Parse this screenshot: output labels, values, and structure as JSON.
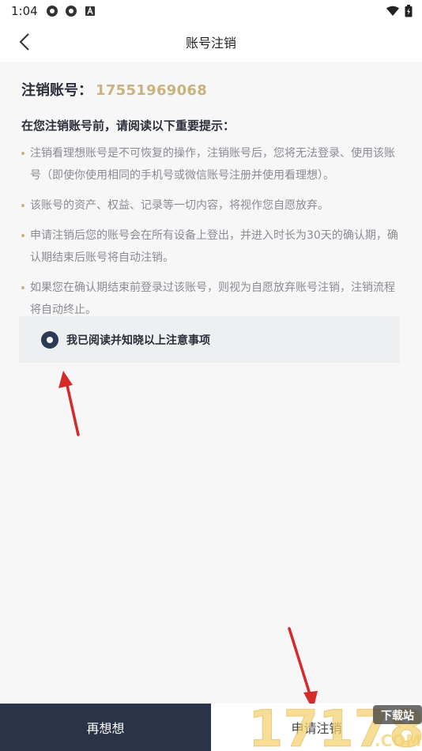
{
  "status_bar": {
    "time": "1:04"
  },
  "header": {
    "title": "账号注销"
  },
  "account": {
    "label": "注销账号：",
    "phone": "17551969068"
  },
  "notice": {
    "title": "在您注销账号前，请阅读以下重要提示：",
    "items": [
      "注销看理想账号是不可恢复的操作，注销账号后，您将无法登录、使用该账号（即使你使用相同的手机号或微信账号注册并使用看理想）。",
      "该账号的资产、权益、记录等一切内容，将视作您自愿放弃。",
      "申请注销后您的账号会在所有设备上登出，并进入时长为30天的确认期，确认期结束后账号将自动注销。",
      "如果您在确认期结束前登录过该账号，则视为自愿放弃账号注销，注销流程将自动终止。"
    ]
  },
  "agreement": {
    "label": "我已阅读并知晓以上注意事项",
    "checked": true
  },
  "actions": {
    "cancel_label": "再想想",
    "apply_label": "申请注销"
  },
  "watermark": {
    "text": "17178",
    "badge": "下载站",
    "suffix": ".COM"
  },
  "colors": {
    "accent_gold": "#c9b37f",
    "dark_navy": "#2b3348",
    "arrow_red": "#d42a2a"
  }
}
